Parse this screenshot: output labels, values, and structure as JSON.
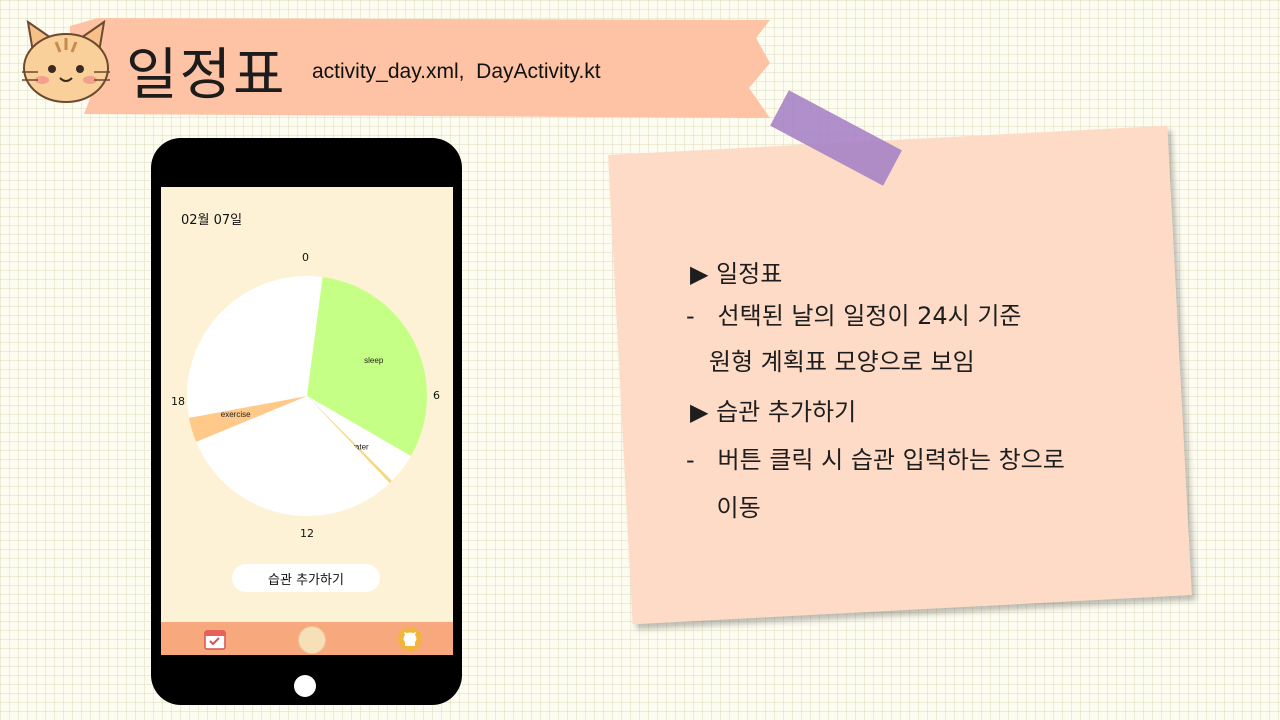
{
  "header": {
    "title": "일정표",
    "files": "activity_day.xml,  DayActivity.kt"
  },
  "phone": {
    "date": "02월 07일",
    "hour_labels": {
      "top": "0",
      "right": "6",
      "bottom": "12",
      "left": "18"
    },
    "habit_button": "습관 추가하기",
    "nav_icons": [
      "calendar-icon",
      "home-icon",
      "github-icon"
    ]
  },
  "chart_data": {
    "type": "pie",
    "start": "0",
    "units": "hours",
    "segments": [
      {
        "label": "",
        "from": 0.33,
        "to": 0.5,
        "color": "#ffffff"
      },
      {
        "label": "sleep",
        "from": 0.5,
        "to": 8.0,
        "color": "#c5ff86"
      },
      {
        "label": "",
        "from": 8.0,
        "to": 9.0,
        "color": "#ffffff"
      },
      {
        "label": "water",
        "from": 9.0,
        "to": 9.1,
        "color": "#f5d77d"
      },
      {
        "label": "",
        "from": 9.1,
        "to": 16.5,
        "color": "#ffffff"
      },
      {
        "label": "exercise",
        "from": 16.5,
        "to": 17.3,
        "color": "#ffc98a"
      },
      {
        "label": "",
        "from": 17.3,
        "to": 24.33,
        "color": "#ffffff"
      }
    ]
  },
  "note": {
    "lines": [
      "▶ 일정표",
      "-   선택된 날의 일정이 24시 기준",
      "   원형 계획표 모양으로 보임",
      "▶ 습관 추가하기",
      "-   버튼 클릭 시 습관 입력하는 창으로",
      "    이동"
    ]
  }
}
